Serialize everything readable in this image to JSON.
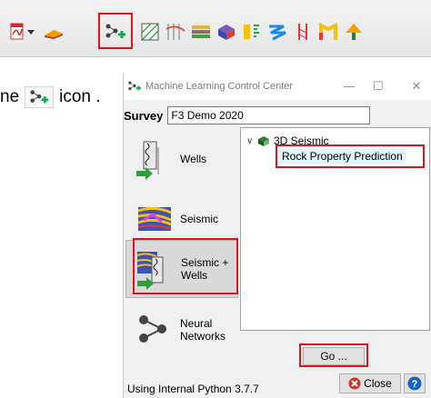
{
  "toolbar": {
    "icons": [
      "pdf-icon",
      "dropdown-arrow-icon",
      "horizon-icon",
      "ml-network-icon",
      "crossplot-icon",
      "well-ties-icon",
      "layer-stack-icon",
      "volume-icon",
      "bars-chart-icon",
      "squiggle-icon",
      "fault-icon",
      "flag-icon",
      "tree-icon"
    ]
  },
  "instruction": {
    "prefix": "ne",
    "suffix": "icon ."
  },
  "dialog": {
    "title": "Machine Learning Control Center",
    "minimize": "—",
    "maximize": "☐",
    "close_x": "✕",
    "survey_label": "Survey",
    "survey_value": "F3 Demo 2020",
    "categories": [
      {
        "label_line1": "Wells",
        "label_line2": "",
        "icon": "wells-icon"
      },
      {
        "label_line1": "Seismic",
        "label_line2": "",
        "icon": "seismic-icon"
      },
      {
        "label_line1": "Seismic +",
        "label_line2": "Wells",
        "icon": "seismic-wells-icon"
      },
      {
        "label_line1": "Neural",
        "label_line2": "Networks",
        "icon": "neural-network-icon"
      }
    ],
    "tree": {
      "parent": "3D Seismic",
      "child": "Rock Property Prediction"
    },
    "go_label": "Go ...",
    "close_label": "Close",
    "help_label": "?",
    "status": "Using Internal Python 3.7.7"
  },
  "colors": {
    "highlight": "#e0141e",
    "selection": "#e5f1fb"
  }
}
